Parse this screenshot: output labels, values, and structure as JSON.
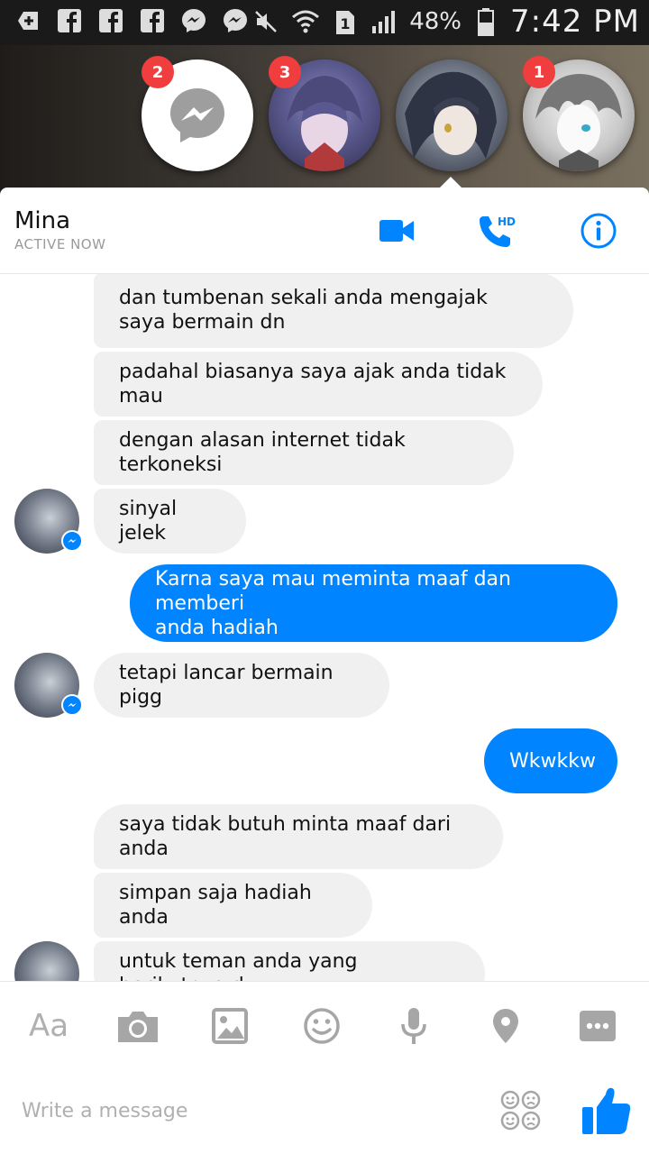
{
  "status_bar": {
    "battery": "48%",
    "time": "7:42 PM",
    "sim": "1"
  },
  "chat_heads": [
    {
      "badge": "2"
    },
    {
      "badge": "3"
    },
    {
      "badge": ""
    },
    {
      "badge": "1"
    }
  ],
  "header": {
    "name": "Mina",
    "status": "ACTIVE NOW",
    "hd_label": "HD"
  },
  "messages": [
    {
      "dir": "in",
      "text_lines": [
        "dan tumbenan sekali anda mengajak",
        "saya bermain dn"
      ]
    },
    {
      "dir": "in",
      "text": "padahal biasanya saya ajak anda tidak mau"
    },
    {
      "dir": "in",
      "text": "dengan alasan internet tidak terkoneksi"
    },
    {
      "dir": "in",
      "text": "sinyal jelek"
    },
    {
      "dir": "out",
      "text_lines": [
        "Karna saya mau meminta maaf dan memberi",
        "anda hadiah"
      ]
    },
    {
      "dir": "in",
      "text": "tetapi lancar bermain pigg"
    },
    {
      "dir": "out",
      "text": "Wkwkkw"
    },
    {
      "dir": "in",
      "text": "saya tidak butuh minta maaf dari anda"
    },
    {
      "dir": "in",
      "text": "simpan saja hadiah anda"
    },
    {
      "dir": "in",
      "text": "untuk teman anda yang berikutnya d"
    }
  ],
  "composer": {
    "aa_label": "Aa",
    "placeholder": "Write a message"
  },
  "colors": {
    "accent": "#0084ff",
    "incoming_bubble": "#f1f0f0",
    "badge": "#f03d3d"
  },
  "icons": {
    "video": "video-camera-icon",
    "call": "phone-hd-icon",
    "info": "info-icon",
    "camera": "camera-icon",
    "gallery": "image-icon",
    "emoji": "emoji-icon",
    "mic": "microphone-icon",
    "location": "location-pin-icon",
    "more": "more-icon",
    "sticker": "sticker-icon",
    "like": "thumbs-up-icon"
  }
}
